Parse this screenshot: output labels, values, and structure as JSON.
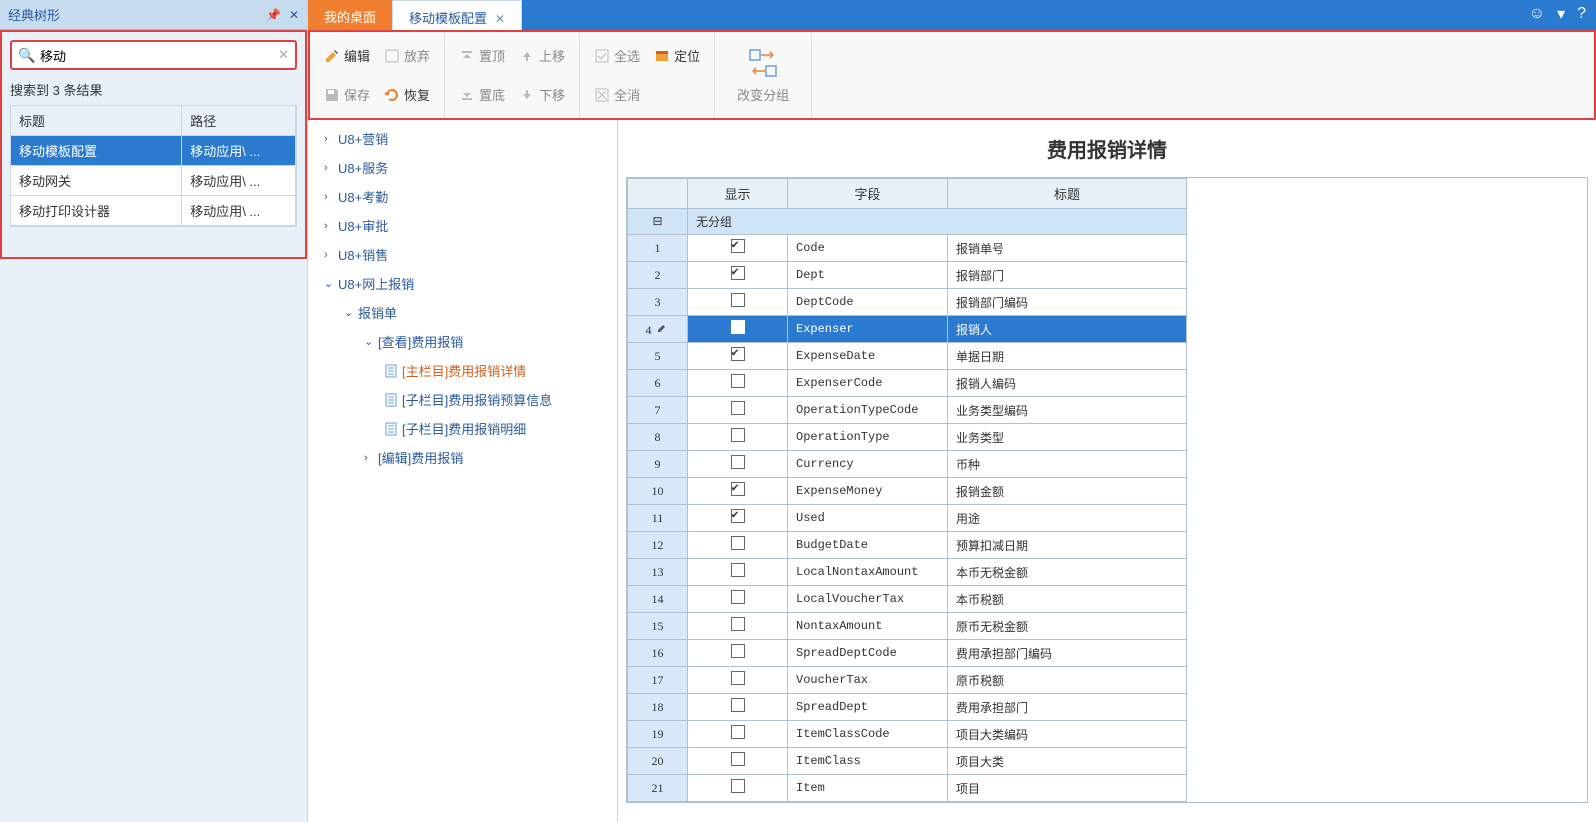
{
  "sidebar": {
    "title": "经典树形",
    "search_value": "移动",
    "search_result": "搜索到 3 条结果",
    "columns": {
      "title": "标题",
      "path": "路径"
    },
    "results": [
      {
        "title": "移动模板配置",
        "path": "移动应用\\ ..."
      },
      {
        "title": "移动网关",
        "path": "移动应用\\ ..."
      },
      {
        "title": "移动打印设计器",
        "path": "移动应用\\ ..."
      }
    ]
  },
  "tabs": {
    "desktop": "我的桌面",
    "current": "移动模板配置"
  },
  "toolbar": {
    "edit": "编辑",
    "discard": "放弃",
    "save": "保存",
    "restore": "恢复",
    "top": "置顶",
    "up": "上移",
    "bottom": "置底",
    "down": "下移",
    "select_all": "全选",
    "locate": "定位",
    "clear_all": "全消",
    "change_group": "改变分组"
  },
  "tree": [
    {
      "level": 1,
      "arrow": "›",
      "label": "U8+营销"
    },
    {
      "level": 1,
      "arrow": "›",
      "label": "U8+服务"
    },
    {
      "level": 1,
      "arrow": "›",
      "label": "U8+考勤"
    },
    {
      "level": 1,
      "arrow": "›",
      "label": "U8+审批"
    },
    {
      "level": 1,
      "arrow": "›",
      "label": "U8+销售"
    },
    {
      "level": 1,
      "arrow": "⌄",
      "label": "U8+网上报销"
    },
    {
      "level": 2,
      "arrow": "⌄",
      "label": "报销单"
    },
    {
      "level": 3,
      "arrow": "⌄",
      "label": "[查看]费用报销"
    },
    {
      "level": 4,
      "doc": true,
      "label": "[主栏目]费用报销详情",
      "orange": true
    },
    {
      "level": 4,
      "doc": true,
      "label": "[子栏目]费用报销预算信息"
    },
    {
      "level": 4,
      "doc": true,
      "label": "[子栏目]费用报销明细"
    },
    {
      "level": 3,
      "arrow": "›",
      "label": "[编辑]费用报销"
    }
  ],
  "detail": {
    "title": "费用报销详情",
    "columns": {
      "show": "显示",
      "field": "字段",
      "title": "标题"
    },
    "group_label": "无分组",
    "rows": [
      {
        "n": 1,
        "c": true,
        "f": "Code",
        "t": "报销单号"
      },
      {
        "n": 2,
        "c": true,
        "f": "Dept",
        "t": "报销部门"
      },
      {
        "n": 3,
        "c": false,
        "f": "DeptCode",
        "t": "报销部门编码"
      },
      {
        "n": 4,
        "c": true,
        "f": "Expenser",
        "t": "报销人",
        "sel": true
      },
      {
        "n": 5,
        "c": true,
        "f": "ExpenseDate",
        "t": "单据日期"
      },
      {
        "n": 6,
        "c": false,
        "f": "ExpenserCode",
        "t": "报销人编码"
      },
      {
        "n": 7,
        "c": false,
        "f": "OperationTypeCode",
        "t": "业务类型编码"
      },
      {
        "n": 8,
        "c": false,
        "f": "OperationType",
        "t": "业务类型"
      },
      {
        "n": 9,
        "c": false,
        "f": "Currency",
        "t": "币种"
      },
      {
        "n": 10,
        "c": true,
        "f": "ExpenseMoney",
        "t": "报销金额"
      },
      {
        "n": 11,
        "c": true,
        "f": "Used",
        "t": "用途"
      },
      {
        "n": 12,
        "c": false,
        "f": "BudgetDate",
        "t": "预算扣减日期"
      },
      {
        "n": 13,
        "c": false,
        "f": "LocalNontaxAmount",
        "t": "本币无税金额"
      },
      {
        "n": 14,
        "c": false,
        "f": "LocalVoucherTax",
        "t": "本币税额"
      },
      {
        "n": 15,
        "c": false,
        "f": "NontaxAmount",
        "t": "原币无税金额"
      },
      {
        "n": 16,
        "c": false,
        "f": "SpreadDeptCode",
        "t": "费用承担部门编码"
      },
      {
        "n": 17,
        "c": false,
        "f": "VoucherTax",
        "t": "原币税额"
      },
      {
        "n": 18,
        "c": false,
        "f": "SpreadDept",
        "t": "费用承担部门"
      },
      {
        "n": 19,
        "c": false,
        "f": "ItemClassCode",
        "t": "项目大类编码"
      },
      {
        "n": 20,
        "c": false,
        "f": "ItemClass",
        "t": "项目大类"
      },
      {
        "n": 21,
        "c": false,
        "f": "Item",
        "t": "项目"
      }
    ]
  }
}
